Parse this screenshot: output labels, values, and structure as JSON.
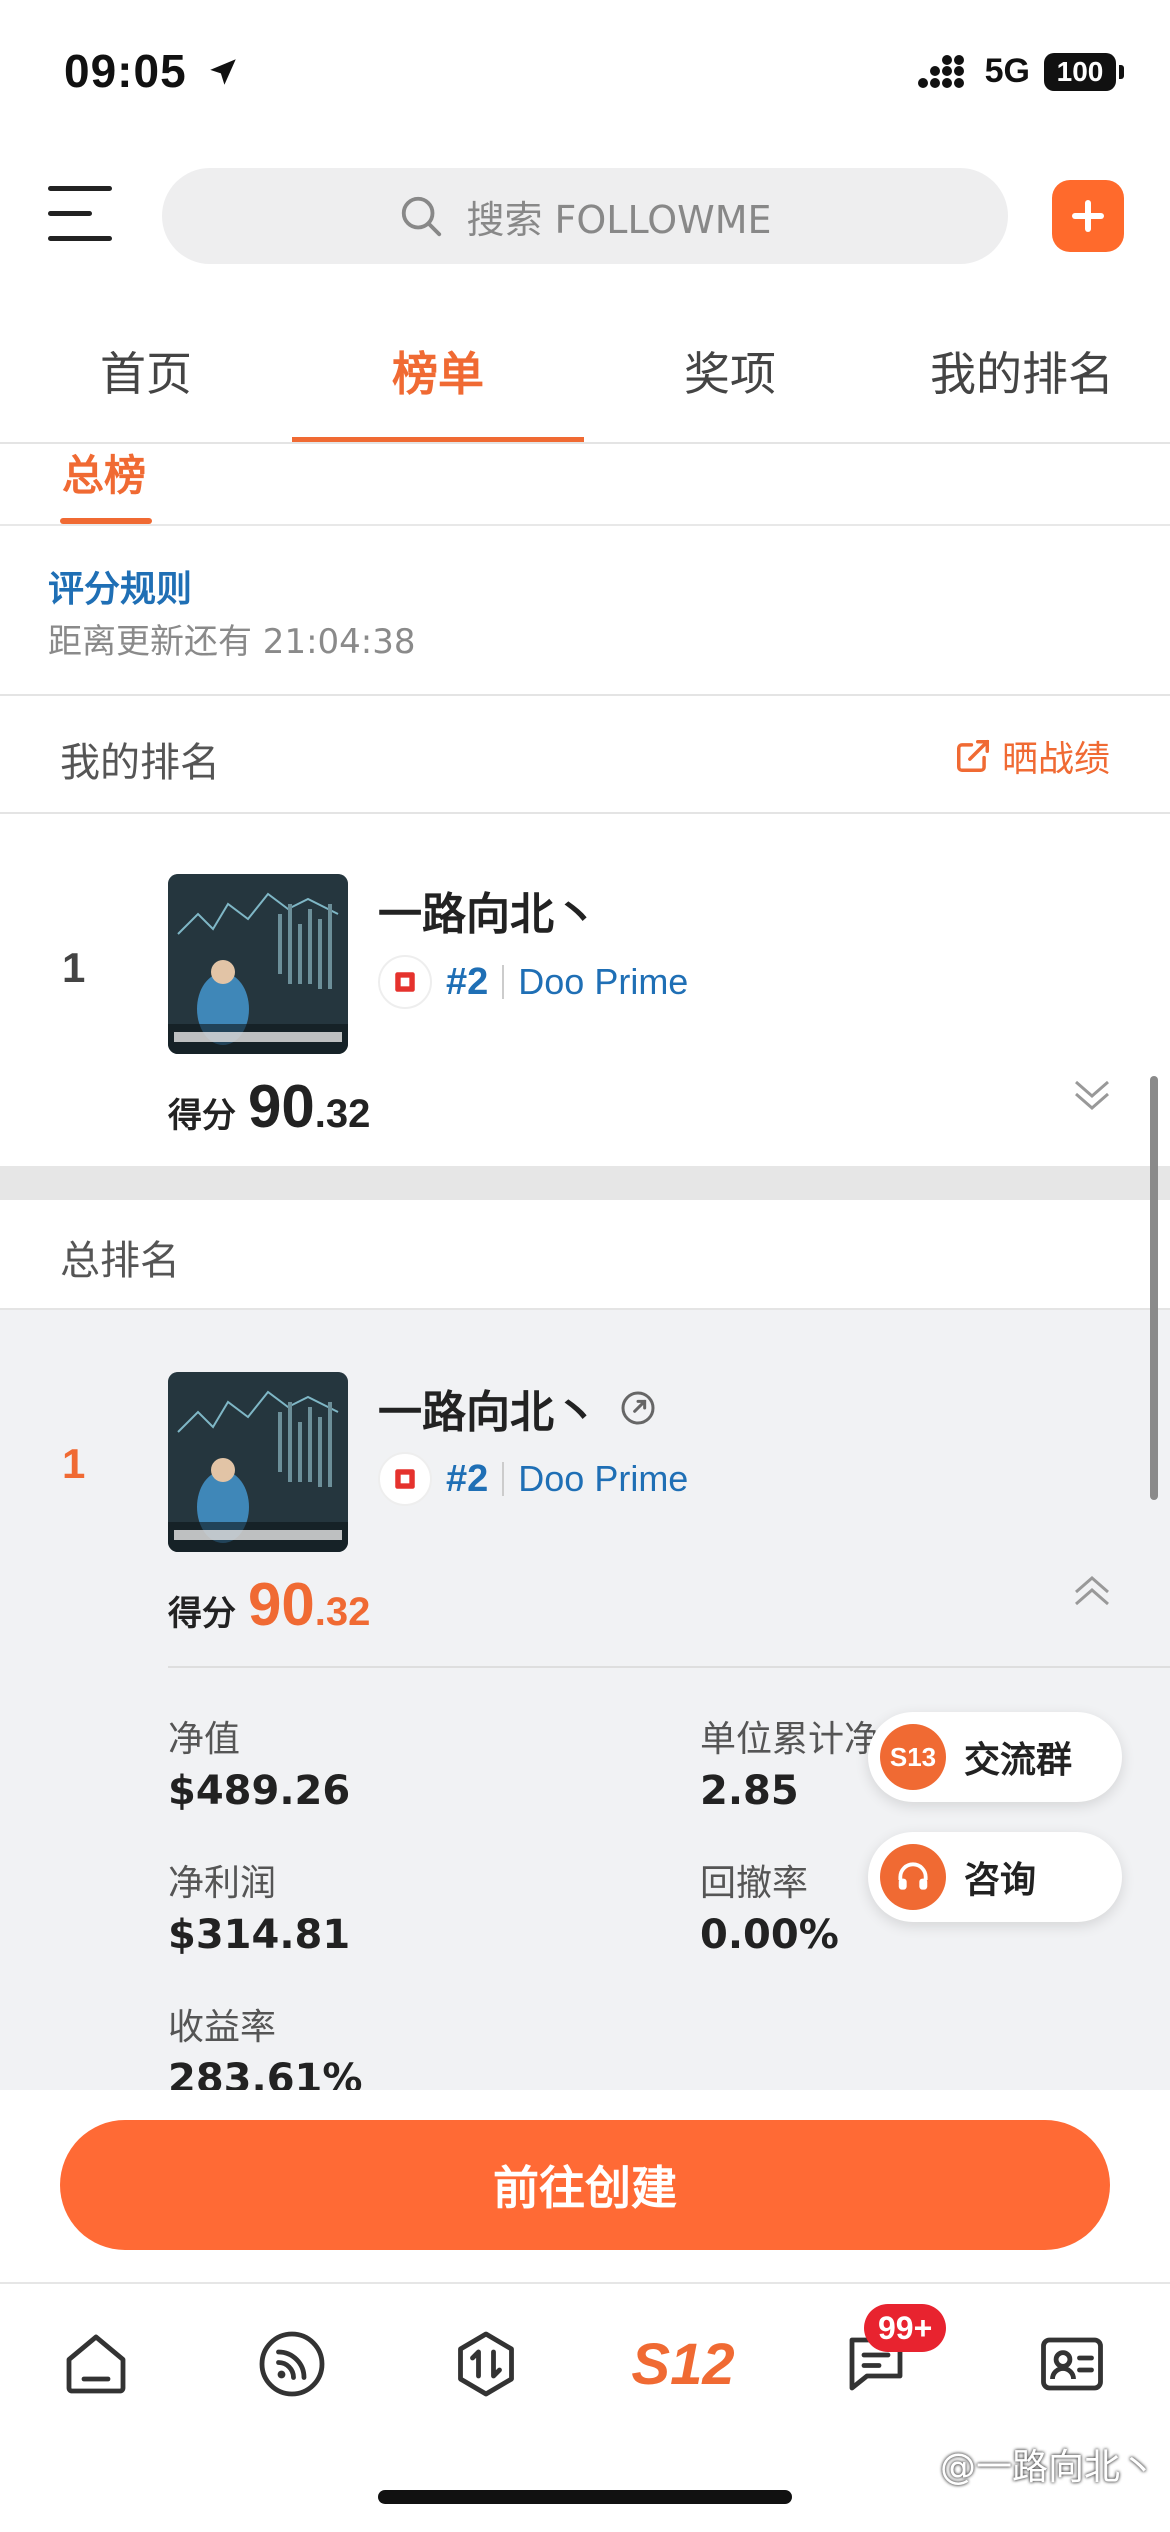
{
  "status_bar": {
    "time": "09:05",
    "network": "5G",
    "battery": "100"
  },
  "header": {
    "search_placeholder": "搜索 FOLLOWME"
  },
  "tabs": [
    {
      "label": "首页"
    },
    {
      "label": "榜单"
    },
    {
      "label": "奖项"
    },
    {
      "label": "我的排名"
    }
  ],
  "subtab": {
    "label": "总榜"
  },
  "rules": {
    "link": "评分规则",
    "countdown": "距离更新还有 21:04:38"
  },
  "my_rank": {
    "title": "我的排名",
    "share_label": "晒战绩",
    "rank": "1",
    "name": "一路向北丶",
    "broker_rank": "#2",
    "broker": "Doo Prime",
    "score_label": "得分",
    "score_int": "90",
    "score_dec": ".32"
  },
  "total_rank": {
    "title": "总排名",
    "rank": "1",
    "name": "一路向北丶",
    "broker_rank": "#2",
    "broker": "Doo Prime",
    "score_label": "得分",
    "score_int": "90",
    "score_dec": ".32",
    "stats": {
      "net_value_label": "净值",
      "net_value": "$489.26",
      "unit_nav_label": "单位累计净",
      "unit_nav": "2.85",
      "net_profit_label": "净利润",
      "net_profit": "$314.81",
      "drawdown_label": "回撤率",
      "drawdown": "0.00%",
      "return_label": "收益率",
      "return": "283.61%"
    }
  },
  "floating": {
    "group_icon_text": "S13",
    "group_label": "交流群",
    "consult_label": "咨询"
  },
  "create_button": "前往创建",
  "bottom_nav": {
    "s12_label": "S12",
    "badge": "99+"
  },
  "watermark": "@一路向北丶",
  "colors": {
    "accent": "#f06a33",
    "link": "#1f6fb5",
    "badge": "#e8232f"
  }
}
